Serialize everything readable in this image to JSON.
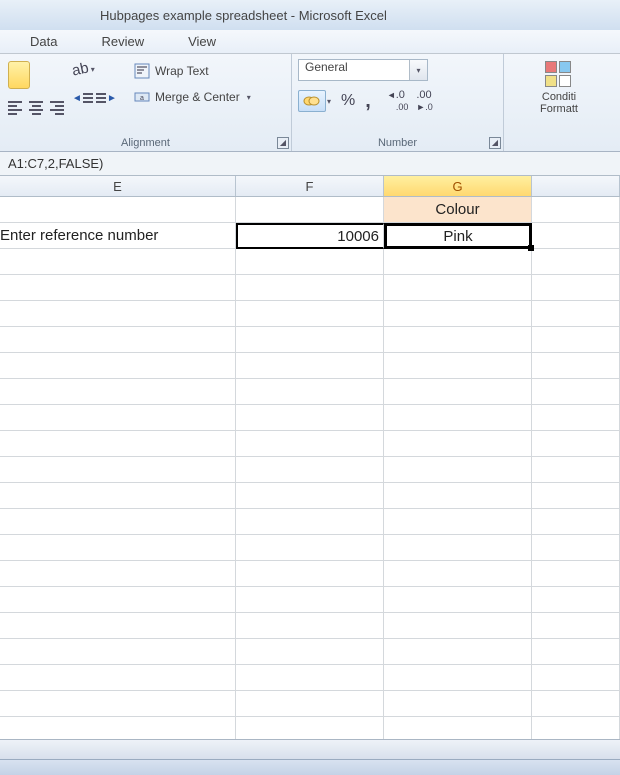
{
  "title": "Hubpages example spreadsheet  -  Microsoft Excel",
  "menu": {
    "data": "Data",
    "review": "Review",
    "view": "View"
  },
  "ribbon": {
    "alignment": {
      "label": "Alignment",
      "wrap_text": "Wrap Text",
      "merge_center": "Merge & Center"
    },
    "number": {
      "label": "Number",
      "format": "General",
      "percent": "%",
      "comma": ",",
      "inc_dec": ".0",
      "dec_dec": ".00"
    },
    "styles": {
      "cond_fmt_l1": "Conditi",
      "cond_fmt_l2": "Formatt"
    }
  },
  "formula_bar": "A1:C7,2,FALSE)",
  "columns": {
    "E": "E",
    "F": "F",
    "G": "G"
  },
  "cells": {
    "G1": "Colour",
    "E2": "Enter reference number",
    "F2": "10006",
    "G2": "Pink"
  }
}
